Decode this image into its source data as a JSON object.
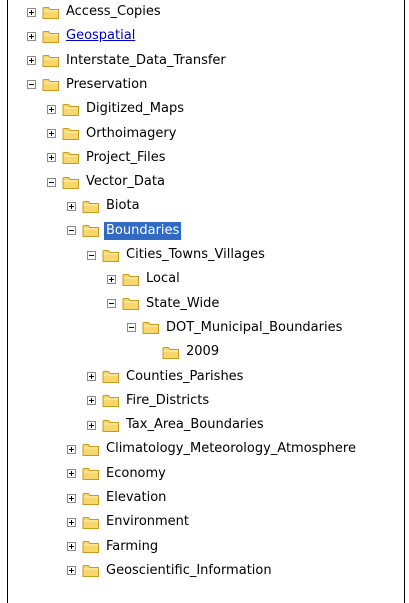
{
  "tree": {
    "nodes": [
      {
        "label": "Access_Copies",
        "depth": 0,
        "state": "collapsed"
      },
      {
        "label": "Geospatial",
        "depth": 0,
        "state": "collapsed",
        "style": "link"
      },
      {
        "label": "Interstate_Data_Transfer",
        "depth": 0,
        "state": "collapsed"
      },
      {
        "label": "Preservation",
        "depth": 0,
        "state": "expanded"
      },
      {
        "label": "Digitized_Maps",
        "depth": 1,
        "state": "collapsed"
      },
      {
        "label": "Orthoimagery",
        "depth": 1,
        "state": "collapsed"
      },
      {
        "label": "Project_Files",
        "depth": 1,
        "state": "collapsed"
      },
      {
        "label": "Vector_Data",
        "depth": 1,
        "state": "expanded"
      },
      {
        "label": "Biota",
        "depth": 2,
        "state": "collapsed"
      },
      {
        "label": "Boundaries",
        "depth": 2,
        "state": "expanded",
        "style": "selected"
      },
      {
        "label": "Cities_Towns_Villages",
        "depth": 3,
        "state": "expanded"
      },
      {
        "label": "Local",
        "depth": 4,
        "state": "collapsed"
      },
      {
        "label": "State_Wide",
        "depth": 4,
        "state": "expanded"
      },
      {
        "label": "DOT_Municipal_Boundaries",
        "depth": 5,
        "state": "expanded"
      },
      {
        "label": "2009",
        "depth": 6,
        "state": "leaf"
      },
      {
        "label": "Counties_Parishes",
        "depth": 3,
        "state": "collapsed"
      },
      {
        "label": "Fire_Districts",
        "depth": 3,
        "state": "collapsed"
      },
      {
        "label": "Tax_Area_Boundaries",
        "depth": 3,
        "state": "collapsed"
      },
      {
        "label": "Climatology_Meteorology_Atmosphere",
        "depth": 2,
        "state": "collapsed"
      },
      {
        "label": "Economy",
        "depth": 2,
        "state": "collapsed"
      },
      {
        "label": "Elevation",
        "depth": 2,
        "state": "collapsed"
      },
      {
        "label": "Environment",
        "depth": 2,
        "state": "collapsed"
      },
      {
        "label": "Farming",
        "depth": 2,
        "state": "collapsed"
      },
      {
        "label": "Geoscientific_Information",
        "depth": 2,
        "state": "collapsed"
      }
    ]
  },
  "icon": "folder-icon",
  "colors": {
    "selection": "#316ac5",
    "link": "#0000cc",
    "folder_fill": "#f7d66b",
    "folder_stroke": "#c69a1e"
  }
}
